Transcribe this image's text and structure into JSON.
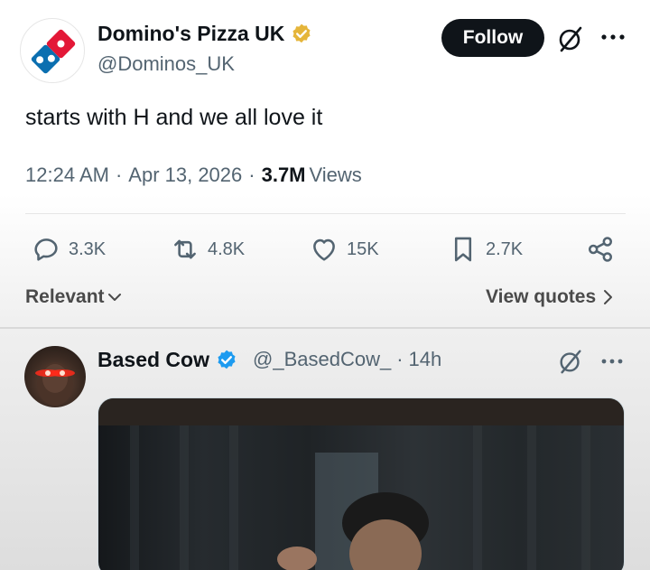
{
  "main_tweet": {
    "display_name": "Domino's Pizza UK",
    "handle": "@Dominos_UK",
    "follow_label": "Follow",
    "text": "starts with H and we all love it",
    "time": "12:24 AM",
    "date": "Apr 13, 2026",
    "views_count": "3.7M",
    "views_label": "Views",
    "verified_badge": "gold-verified-icon",
    "brand_colors": {
      "blue": "#0b6fb0",
      "red": "#e31837"
    }
  },
  "actions": {
    "replies": "3.3K",
    "reposts": "4.8K",
    "likes": "15K",
    "bookmarks": "2.7K"
  },
  "sort": {
    "relevant_label": "Relevant",
    "view_quotes_label": "View quotes"
  },
  "reply": {
    "display_name": "Based Cow",
    "handle": "@_BasedCow_",
    "time": "14h",
    "verified_badge": "blue-verified-icon"
  },
  "meta_separator": "·"
}
